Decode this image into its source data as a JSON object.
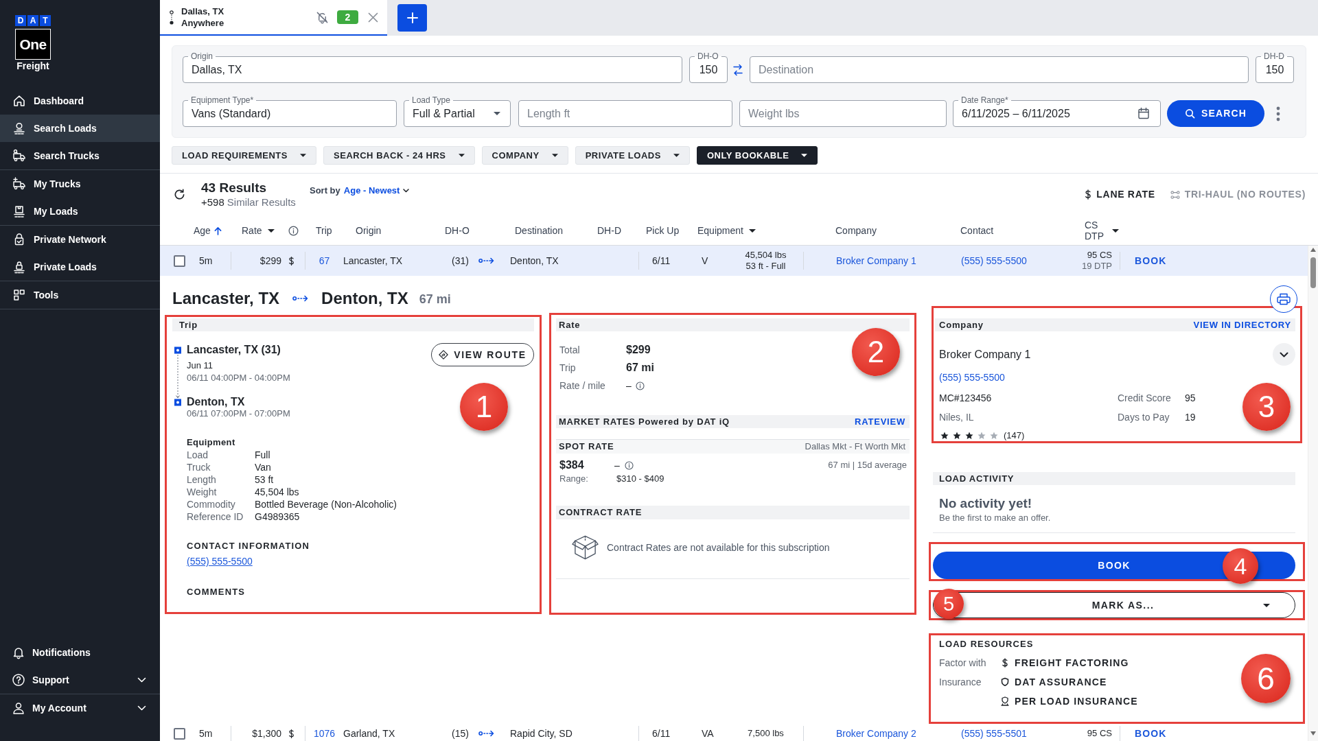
{
  "sidebar": {
    "logo": {
      "letters": [
        "D",
        "A",
        "T"
      ],
      "wordmark": "One",
      "caption": "Freight"
    },
    "nav_groups": [
      {
        "items": [
          {
            "label": "Dashboard",
            "selected": false
          },
          {
            "label": "Search Loads",
            "selected": true
          },
          {
            "label": "Search Trucks",
            "selected": false
          }
        ]
      },
      {
        "items": [
          {
            "label": "My Trucks",
            "selected": false
          },
          {
            "label": "My Loads",
            "selected": false
          }
        ]
      },
      {
        "items": [
          {
            "label": "Private Network",
            "selected": false
          },
          {
            "label": "Private Loads",
            "selected": false
          }
        ]
      },
      {
        "items": [
          {
            "label": "Tools",
            "selected": false
          }
        ]
      }
    ],
    "footer": [
      {
        "label": "Notifications",
        "expandable": false
      },
      {
        "label": "Support",
        "expandable": true
      },
      {
        "label": "My Account",
        "expandable": true
      }
    ]
  },
  "search_tabs": [
    {
      "origin": "Dallas, TX",
      "destination": "Anywhere",
      "alert_count": "2",
      "selected": true
    }
  ],
  "search_form": {
    "origin": {
      "label": "Origin",
      "value": "Dallas, TX"
    },
    "dh_o": {
      "label": "DH-O",
      "value": "150"
    },
    "destination": {
      "placeholder": "Destination"
    },
    "dh_d": {
      "label": "DH-D",
      "value": "150"
    },
    "equipment_type": {
      "label": "Equipment Type*",
      "value": "Vans (Standard)"
    },
    "load_type": {
      "label": "Load Type",
      "value": "Full & Partial"
    },
    "length": {
      "placeholder": "Length ft"
    },
    "weight": {
      "placeholder": "Weight lbs"
    },
    "date_range": {
      "label": "Date Range*",
      "value": "6/11/2025 – 6/11/2025"
    },
    "search_button": "SEARCH"
  },
  "filters": [
    {
      "label": "LOAD REQUIREMENTS",
      "selected": false
    },
    {
      "label": "SEARCH BACK - 24 HRS",
      "selected": false
    },
    {
      "label": "COMPANY",
      "selected": false
    },
    {
      "label": "PRIVATE LOADS",
      "selected": false
    },
    {
      "label": "ONLY BOOKABLE",
      "selected": true
    }
  ],
  "results": {
    "count": "43 Results",
    "similar_count": "+598",
    "similar_label": "Similar Results",
    "sort_label": "Sort by",
    "sort_value": "Age - Newest",
    "lane_rate": {
      "label": "LANE RATE",
      "disabled": false
    },
    "tri_haul": {
      "label": "TRI-HAUL (NO ROUTES)",
      "disabled": true
    }
  },
  "table": {
    "columns": [
      {
        "label": "Age",
        "kind": "sort"
      },
      {
        "label": "Rate",
        "kind": "menu"
      },
      {
        "kind": "info"
      },
      {
        "label": "Trip",
        "kind": "plain"
      },
      {
        "label": "Origin",
        "kind": "plain"
      },
      {
        "label": "DH-O",
        "kind": "plain"
      },
      {
        "label": "Destination",
        "kind": "plain"
      },
      {
        "label": "DH-D",
        "kind": "plain"
      },
      {
        "label": "Pick Up",
        "kind": "plain"
      },
      {
        "label": "Equipment",
        "kind": "menu"
      },
      {
        "label": "Company",
        "kind": "plain"
      },
      {
        "label": "Contact",
        "kind": "plain"
      },
      {
        "label": "CS DTP",
        "kind": "menu"
      }
    ],
    "rows": [
      {
        "expanded": true,
        "checked": false,
        "age": "5m",
        "rate": "$299",
        "trip": "67",
        "origin": "Lancaster, TX",
        "dh_o": "(31)",
        "destination": "Denton, TX",
        "pickup": "6/11",
        "equipment": "V",
        "weight": "45,504 lbs",
        "size": "53 ft - Full",
        "company": "Broker Company 1",
        "contact": "(555) 555-5500",
        "credit_score": "95 CS",
        "days_to_pay": "19 DTP",
        "action": "BOOK",
        "detail": {
          "origin": "Lancaster, TX",
          "destination": "Denton, TX",
          "distance": "67 mi",
          "trip": {
            "title": "Trip",
            "stops": [
              {
                "place": "Lancaster, TX (31)",
                "date": "Jun 11",
                "window": "06/11 04:00PM - 04:00PM"
              },
              {
                "place": "Denton, TX",
                "window": "06/11 07:00PM - 07:00PM"
              }
            ],
            "view_route": "VIEW ROUTE",
            "equipment_title": "Equipment",
            "equipment": [
              {
                "label": "Load",
                "value": "Full"
              },
              {
                "label": "Truck",
                "value": "Van"
              },
              {
                "label": "Length",
                "value": "53 ft"
              },
              {
                "label": "Weight",
                "value": "45,504 lbs"
              },
              {
                "label": "Commodity",
                "value": "Bottled Beverage (Non-Alcoholic)"
              },
              {
                "label": "Reference ID",
                "value": "G4989365"
              }
            ],
            "contact_title": "CONTACT INFORMATION",
            "contact_phone": "(555) 555-5500",
            "comments_title": "COMMENTS"
          },
          "rate": {
            "title": "Rate",
            "items": [
              {
                "label": "Total",
                "value": "$299",
                "kind": "amount"
              },
              {
                "label": "Trip",
                "value": "67 mi",
                "kind": "amount"
              },
              {
                "label": "Rate / mile",
                "value": "–",
                "kind": "info"
              }
            ],
            "market_title": "MARKET RATES Powered by DAT iQ",
            "market_link": "RATEVIEW",
            "spot": {
              "title": "SPOT RATE",
              "market": "Dallas Mkt - Ft Worth Mkt",
              "value": "$384",
              "change": "–",
              "basis": "67 mi | 15d average",
              "range_label": "Range:",
              "range": "$310 - $409"
            },
            "contract": {
              "title": "CONTRACT RATE",
              "message": "Contract Rates are not available for this subscription"
            }
          },
          "company": {
            "title": "Company",
            "link": "VIEW IN DIRECTORY",
            "name": "Broker Company 1",
            "phone": "(555) 555-5500",
            "mc": "MC#123456",
            "location": "Niles, IL",
            "stats": [
              {
                "label": "Credit Score",
                "value": "95"
              },
              {
                "label": "Days to Pay",
                "value": "19"
              }
            ],
            "stars": 3,
            "reviews": "(147)"
          },
          "activity": {
            "title": "LOAD ACTIVITY",
            "headline": "No activity yet!",
            "message": "Be the first to make an offer."
          },
          "book_button": "BOOK",
          "mark_as": "MARK AS...",
          "resources": {
            "title": "LOAD RESOURCES",
            "rows": [
              {
                "label": "Factor with",
                "kind": "dollar",
                "link": "FREIGHT FACTORING"
              },
              {
                "label": "Insurance",
                "kind": "shield",
                "link": "DAT ASSURANCE"
              },
              {
                "kind": "shield_stand",
                "link": "PER LOAD INSURANCE"
              }
            ]
          }
        }
      },
      {
        "expanded": false,
        "checked": false,
        "age": "5m",
        "rate": "$1,300",
        "trip": "1076",
        "origin": "Garland, TX",
        "dh_o": "(15)",
        "destination": "Rapid City, SD",
        "pickup": "6/11",
        "equipment": "VA",
        "weight": "7,500 lbs",
        "company": "Broker Company 2",
        "contact": "(555) 555-5501",
        "credit_score": "95 CS",
        "action": "BOOK"
      }
    ]
  },
  "annotations": [
    {
      "number": "1"
    },
    {
      "number": "2"
    },
    {
      "number": "3"
    },
    {
      "number": "4"
    },
    {
      "number": "5"
    },
    {
      "number": "6"
    }
  ]
}
